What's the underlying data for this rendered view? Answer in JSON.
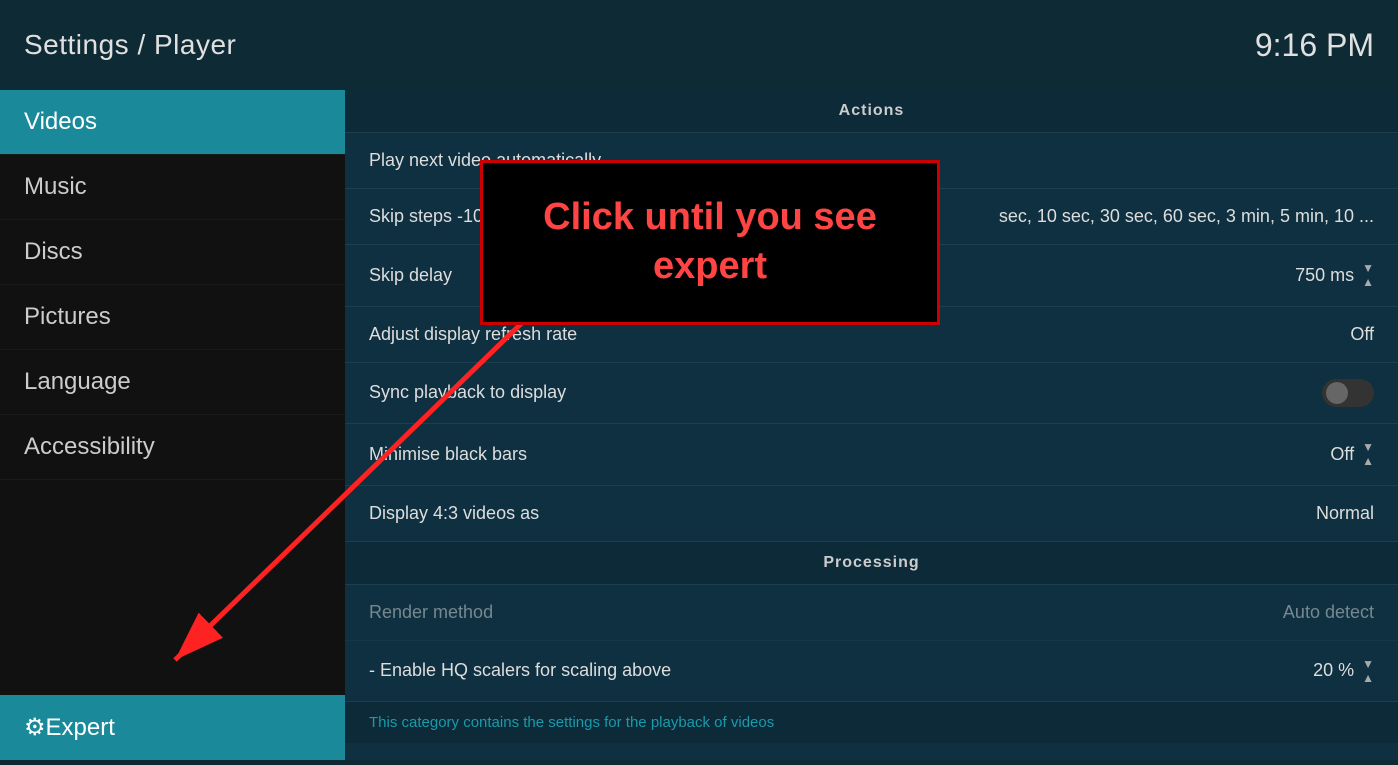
{
  "header": {
    "title": "Settings / Player",
    "time": "9:16 PM"
  },
  "sidebar": {
    "items": [
      {
        "id": "videos",
        "label": "Videos",
        "active": true
      },
      {
        "id": "music",
        "label": "Music",
        "active": false
      },
      {
        "id": "discs",
        "label": "Discs",
        "active": false
      },
      {
        "id": "pictures",
        "label": "Pictures",
        "active": false
      },
      {
        "id": "language",
        "label": "Language",
        "active": false
      },
      {
        "id": "accessibility",
        "label": "Accessibility",
        "active": false
      }
    ],
    "expert": {
      "label": "Expert",
      "icon": "⚙"
    }
  },
  "content": {
    "sections": [
      {
        "id": "actions",
        "title": "Actions",
        "settings": [
          {
            "id": "play-next-video",
            "label": "Play next video automatically",
            "value": "",
            "type": "text"
          },
          {
            "id": "skip-steps",
            "label": "Skip steps  -10 min, ...",
            "value": "sec, 10 sec, 30 sec, 60 sec, 3 min, 5 min, 10 ...",
            "type": "text"
          },
          {
            "id": "skip-delay",
            "label": "Skip delay",
            "value": "750 ms",
            "type": "arrows"
          }
        ]
      },
      {
        "id": "display",
        "title": "",
        "settings": [
          {
            "id": "adjust-display-refresh",
            "label": "Adjust display refresh rate",
            "value": "Off",
            "type": "text"
          },
          {
            "id": "sync-playback",
            "label": "Sync playback to display",
            "value": "",
            "type": "toggle"
          },
          {
            "id": "minimise-black-bars",
            "label": "Minimise black bars",
            "value": "Off",
            "type": "arrows"
          },
          {
            "id": "display-43",
            "label": "Display 4:3 videos as",
            "value": "Normal",
            "type": "text"
          }
        ]
      },
      {
        "id": "processing",
        "title": "Processing",
        "settings": [
          {
            "id": "render-method",
            "label": "Render method",
            "value": "Auto detect",
            "type": "text",
            "disabled": true
          },
          {
            "id": "enable-hq-scalers",
            "label": "- Enable HQ scalers for scaling above",
            "value": "20 %",
            "type": "arrows"
          }
        ]
      }
    ],
    "footer_text": "This category contains the settings for the playback of videos"
  },
  "popup": {
    "text": "Click until you see expert"
  },
  "colors": {
    "active_sidebar": "#1a8a9a",
    "accent": "#1a9aaa",
    "popup_border": "#cc0000",
    "popup_text": "#ff4444"
  }
}
